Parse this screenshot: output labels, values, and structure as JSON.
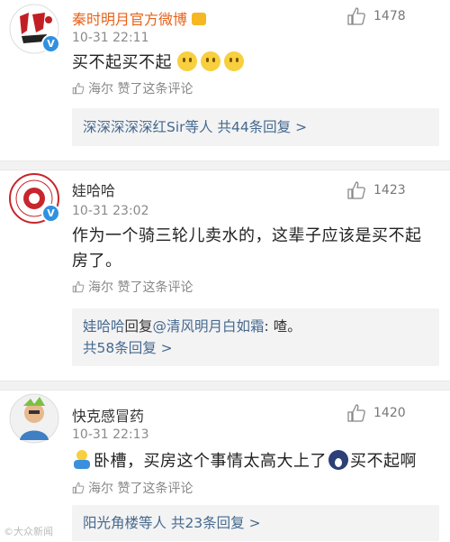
{
  "ui": {
    "like_icon": "thumbs-up-icon",
    "verified_icon": "verified-v-badge",
    "emoji_icon": "pensive-face-emoji"
  },
  "comments": [
    {
      "user": "秦时明月官方微博",
      "time": "10-31 22:11",
      "likes": "1478",
      "text": "买不起买不起",
      "emoji_count": 3,
      "liked_by": "海尔 赞了这条评论",
      "reply_lead": "深深深深深红Sir等人",
      "reply_count": " 共44条回复 >"
    },
    {
      "user": "娃哈哈",
      "time": "10-31 23:02",
      "likes": "1423",
      "text": "作为一个骑三轮儿卖水的，这辈子应该是买不起房了。",
      "liked_by": "海尔 赞了这条评论",
      "reply_from": "娃哈哈",
      "reply_word": "回复",
      "reply_mention": "@清风明月白如霜",
      "reply_text": ": 喳。",
      "reply_count": "共58条回复 >"
    },
    {
      "user": "快克感冒药",
      "time": "10-31 22:13",
      "likes": "1420",
      "text_a": "卧槽，买房这个事情太高大上了",
      "text_b": "买不起啊",
      "liked_by": "海尔 赞了这条评论",
      "reply_lead": "阳光角楼等人",
      "reply_count": " 共23条回复 >"
    }
  ],
  "watermark": "©大众新闻"
}
